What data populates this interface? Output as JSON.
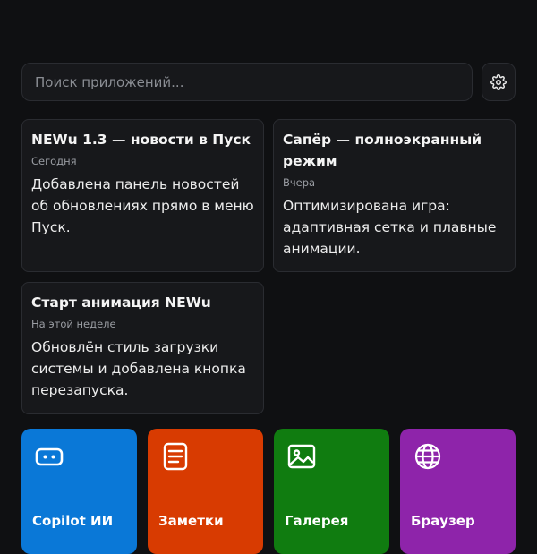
{
  "search": {
    "placeholder": "Поиск приложений..."
  },
  "news": [
    {
      "title": "NEWu 1.3 — новости в Пуск",
      "date": "Сегодня",
      "body": "Добавлена панель новостей об обновлениях прямо в меню Пуск."
    },
    {
      "title": "Сапёр — полноэкранный режим",
      "date": "Вчера",
      "body": "Оптимизирована игра: адаптивная сетка и плавные анимации."
    },
    {
      "title": "Старт анимация NEWu",
      "date": "На этой неделе",
      "body": "Обновлён стиль загрузки системы и добавлена кнопка перезапуска."
    }
  ],
  "tiles": [
    {
      "label": "Copilot ИИ",
      "color": "#0a78d7",
      "icon": "copilot-icon"
    },
    {
      "label": "Заметки",
      "color": "#d83b01",
      "icon": "notes-icon"
    },
    {
      "label": "Галерея",
      "color": "#107c10",
      "icon": "gallery-icon"
    },
    {
      "label": "Браузер",
      "color": "#8e24aa",
      "icon": "globe-icon"
    }
  ]
}
